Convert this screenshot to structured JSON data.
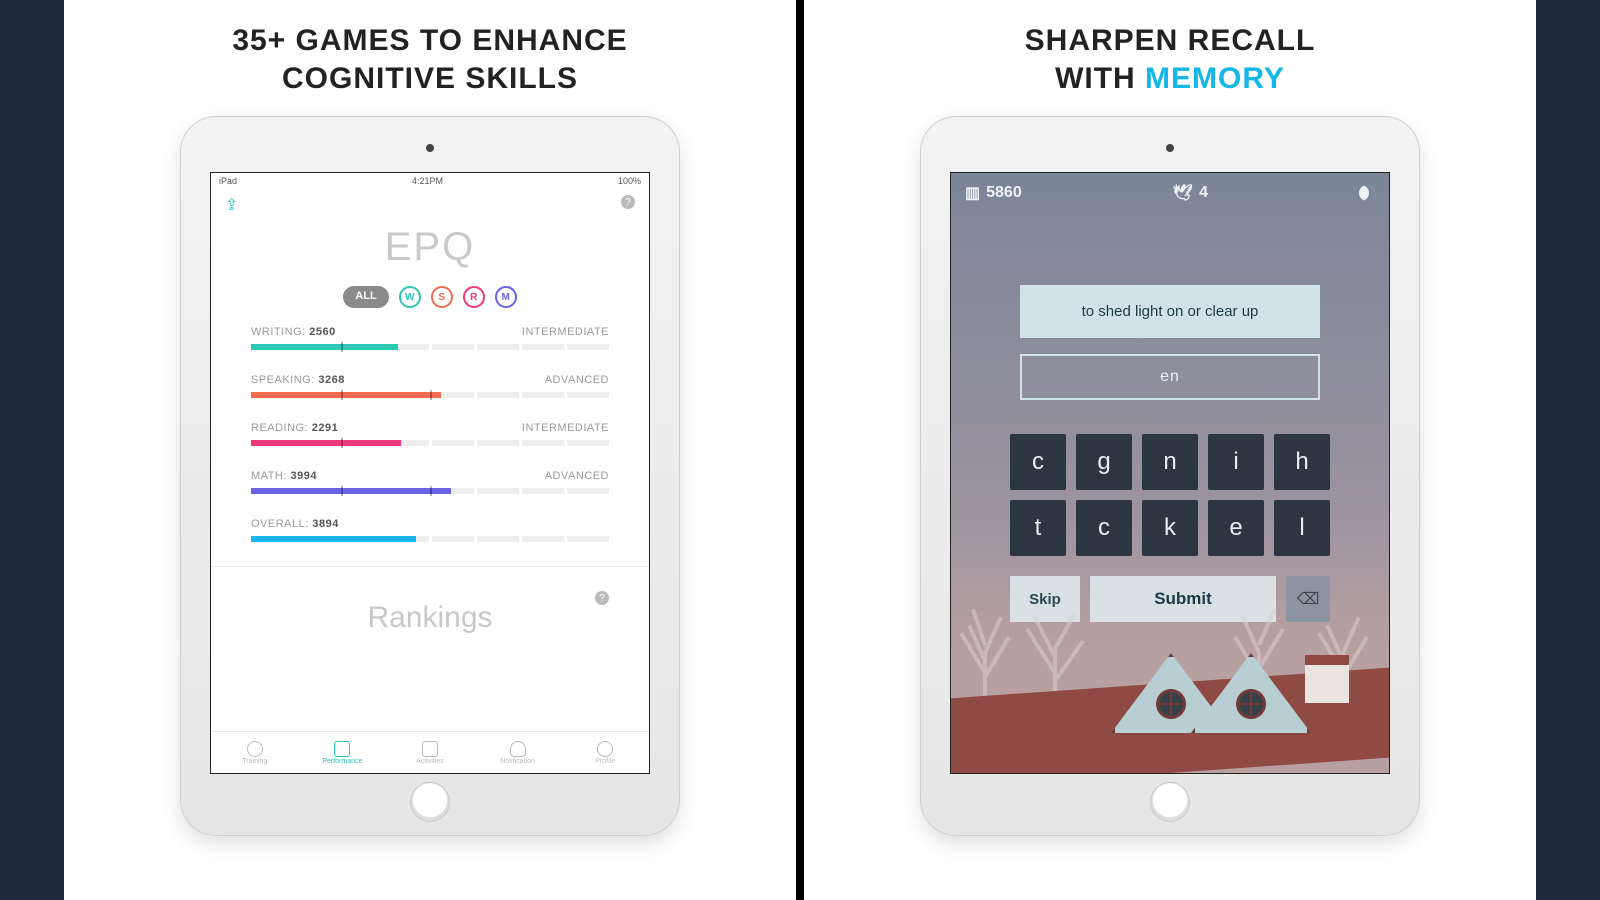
{
  "left": {
    "headline_l1": "35+ GAMES TO ENHANCE",
    "headline_l2": "COGNITIVE SKILLS",
    "status": {
      "device": "iPad",
      "time": "4:21PM",
      "battery": "100%"
    },
    "title": "EPQ",
    "filters": {
      "all": "ALL",
      "w": "W",
      "s": "S",
      "r": "R",
      "m": "M"
    },
    "metrics": [
      {
        "label": "WRITING:",
        "score": "2560",
        "level": "INTERMEDIATE",
        "color": "teal",
        "pct": 41
      },
      {
        "label": "SPEAKING:",
        "score": "3268",
        "level": "ADVANCED",
        "color": "orange",
        "pct": 53
      },
      {
        "label": "READING:",
        "score": "2291",
        "level": "INTERMEDIATE",
        "color": "pink",
        "pct": 42
      },
      {
        "label": "MATH:",
        "score": "3994",
        "level": "ADVANCED",
        "color": "purple",
        "pct": 56
      },
      {
        "label": "OVERALL:",
        "score": "3894",
        "level": "",
        "color": "cyan",
        "pct": 46
      }
    ],
    "rankings": "Rankings",
    "tabs": [
      "Training",
      "Performance",
      "Activities",
      "Notification",
      "Profile"
    ],
    "active_tab": 1
  },
  "right": {
    "headline_l1": "SHARPEN RECALL",
    "headline_l2a": "WITH ",
    "headline_l2b": "MEMORY",
    "hud": {
      "score": "5860",
      "lives": "4"
    },
    "clue": "to shed light on or clear up",
    "answer": "en",
    "tiles": [
      "c",
      "g",
      "n",
      "i",
      "h",
      "t",
      "c",
      "k",
      "e",
      "l"
    ],
    "skip": "Skip",
    "submit": "Submit",
    "backspace": "⌫"
  }
}
